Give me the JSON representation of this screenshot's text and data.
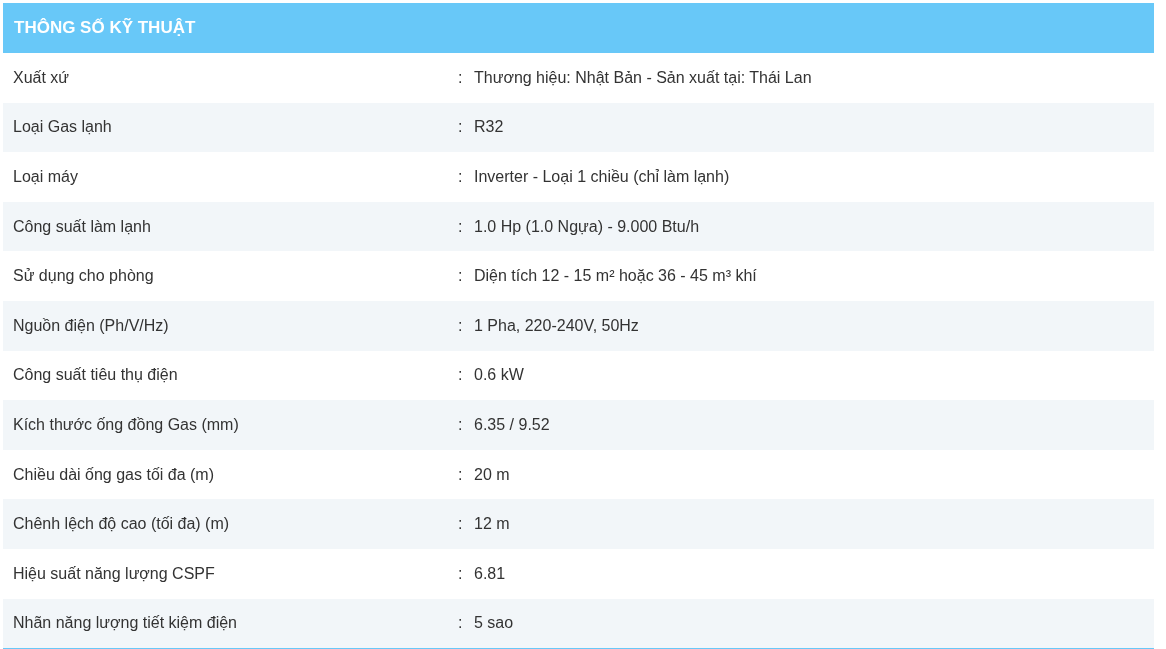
{
  "title": "THÔNG SỐ KỸ THUẬT",
  "rows": [
    {
      "label": "Xuất xứ",
      "separator": ":",
      "value": "Thương hiệu: Nhật Bản - Sản xuất tại: Thái Lan"
    },
    {
      "label": "Loại Gas lạnh",
      "separator": ":",
      "value": "R32"
    },
    {
      "label": "Loại máy",
      "separator": ":",
      "value": "Inverter - Loại 1 chiều (chỉ làm lạnh)"
    },
    {
      "label": "Công suất làm lạnh",
      "separator": ":",
      "value": "1.0 Hp (1.0 Ngựa) - 9.000 Btu/h"
    },
    {
      "label": "Sử dụng cho phòng",
      "separator": ":",
      "value": "Diện tích 12 - 15 m² hoặc 36 - 45 m³ khí"
    },
    {
      "label": "Nguồn điện (Ph/V/Hz)",
      "separator": ":",
      "value": "1 Pha, 220-240V, 50Hz"
    },
    {
      "label": "Công suất tiêu thụ điện",
      "separator": ":",
      "value": "0.6 kW"
    },
    {
      "label": "Kích thước ống đồng Gas (mm)",
      "separator": ":",
      "value": "6.35 / 9.52"
    },
    {
      "label": "Chiều dài ống gas tối đa (m)",
      "separator": ":",
      "value": "20 m"
    },
    {
      "label": "Chênh lệch độ cao (tối đa) (m)",
      "separator": ":",
      "value": "12 m"
    },
    {
      "label": "Hiệu suất năng lượng CSPF",
      "separator": ":",
      "value": "6.81"
    },
    {
      "label": "Nhãn năng lượng tiết kiệm điện",
      "separator": ":",
      "value": "5 sao"
    }
  ]
}
